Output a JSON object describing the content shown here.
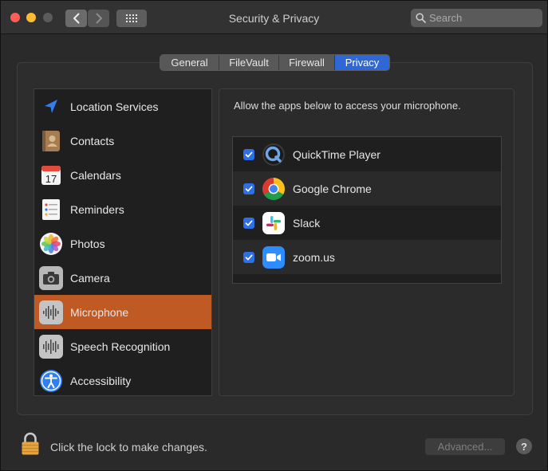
{
  "window": {
    "title": "Security & Privacy",
    "search_placeholder": "Search"
  },
  "tabs": [
    {
      "label": "General",
      "active": false
    },
    {
      "label": "FileVault",
      "active": false
    },
    {
      "label": "Firewall",
      "active": false
    },
    {
      "label": "Privacy",
      "active": true
    }
  ],
  "sidebar": {
    "items": [
      {
        "label": "Location Services",
        "icon": "location-arrow-icon"
      },
      {
        "label": "Contacts",
        "icon": "contacts-book-icon"
      },
      {
        "label": "Calendars",
        "icon": "calendar-icon",
        "icon_text": "17"
      },
      {
        "label": "Reminders",
        "icon": "reminders-list-icon"
      },
      {
        "label": "Photos",
        "icon": "photos-flower-icon"
      },
      {
        "label": "Camera",
        "icon": "camera-icon"
      },
      {
        "label": "Microphone",
        "icon": "microphone-waveform-icon",
        "selected": true
      },
      {
        "label": "Speech Recognition",
        "icon": "speech-waveform-icon"
      },
      {
        "label": "Accessibility",
        "icon": "accessibility-person-icon"
      }
    ]
  },
  "main": {
    "prompt": "Allow the apps below to access your microphone.",
    "apps": [
      {
        "label": "QuickTime Player",
        "checked": true,
        "icon": "quicktime-icon"
      },
      {
        "label": "Google Chrome",
        "checked": true,
        "icon": "chrome-icon"
      },
      {
        "label": "Slack",
        "checked": true,
        "icon": "slack-icon"
      },
      {
        "label": "zoom.us",
        "checked": true,
        "icon": "zoom-icon"
      }
    ]
  },
  "footer": {
    "lock_text": "Click the lock to make changes.",
    "advanced_label": "Advanced...",
    "help_label": "?"
  },
  "colors": {
    "accent_selected": "#c05a25",
    "tab_active": "#2f68d6",
    "checkbox": "#2f6fe4"
  }
}
